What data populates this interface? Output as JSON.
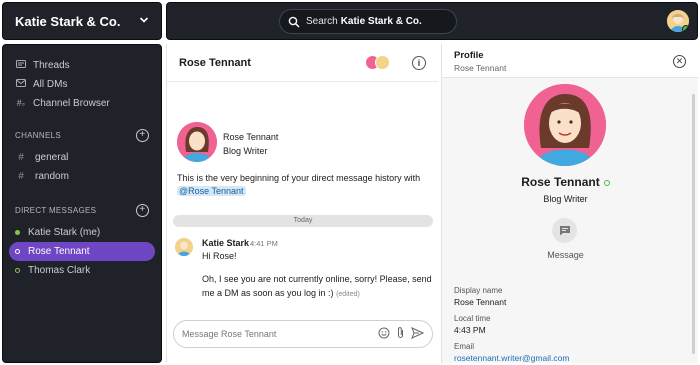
{
  "workspace": {
    "name": "Katie Stark & Co."
  },
  "search": {
    "prefix": "Search",
    "scope": "Katie Stark & Co."
  },
  "sidebar": {
    "nav": [
      {
        "label": "Threads",
        "icon": "threads-icon"
      },
      {
        "label": "All DMs",
        "icon": "all-dms-icon"
      },
      {
        "label": "Channel Browser",
        "icon": "channel-browser-icon"
      }
    ],
    "channels_heading": "CHANNELS",
    "channels": [
      {
        "label": "general"
      },
      {
        "label": "random"
      }
    ],
    "dms_heading": "DIRECT MESSAGES",
    "dms": [
      {
        "label": "Katie Stark (me)",
        "status_color": "#8bc34a",
        "active": false
      },
      {
        "label": "Rose Tennant",
        "status_color": "#ffffff",
        "active": true
      },
      {
        "label": "Thomas Clark",
        "status_color": "#8bc34a",
        "active": false
      }
    ]
  },
  "chat": {
    "title": "Rose Tennant",
    "intro_name": "Rose Tennant",
    "intro_role": "Blog Writer",
    "intro_text": "This is the very beginning of your direct message history with",
    "intro_mention": "@Rose Tennant",
    "divider": "Today",
    "message": {
      "author": "Katie Stark",
      "time": "4:41 PM",
      "line1": "Hi Rose!",
      "line2": "Oh, I see you are not currently online, sorry! Please, send me a DM as soon as you log in :)",
      "edited": "(edited)"
    },
    "composer_placeholder": "Message Rose Tennant"
  },
  "profile": {
    "title": "Profile",
    "subtitle": "Rose Tennant",
    "name": "Rose Tennant",
    "role": "Blog Writer",
    "message_label": "Message",
    "fields": [
      {
        "label": "Display name",
        "value": "Rose Tennant"
      },
      {
        "label": "Local time",
        "value": "4:43 PM"
      },
      {
        "label": "Email",
        "value": "rosetennant.writer@gmail.com"
      }
    ]
  },
  "colors": {
    "accent": "#6f47c4",
    "online": "#4cba4c",
    "link": "#1d6fb8"
  }
}
